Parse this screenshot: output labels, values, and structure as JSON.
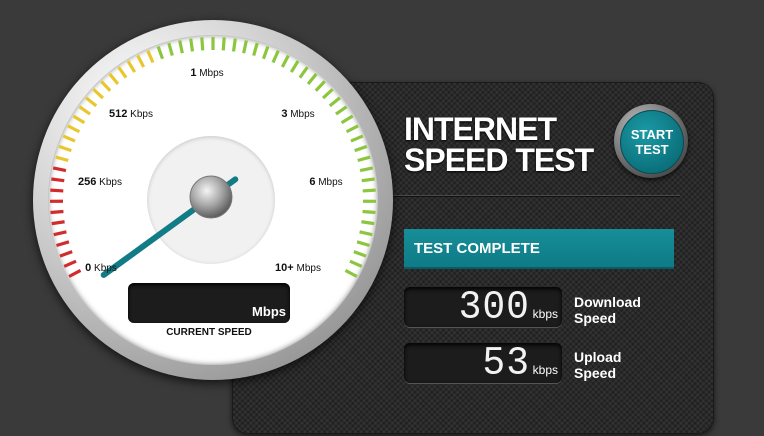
{
  "title_line1": "INTERNET",
  "title_line2": "SPEED TEST",
  "start_button": {
    "line1": "START",
    "line2": "TEST"
  },
  "status": "TEST COMPLETE",
  "download": {
    "value": "300",
    "unit": "kbps",
    "label_line1": "Download",
    "label_line2": "Speed"
  },
  "upload": {
    "value": "53",
    "unit": "kbps",
    "label_line1": "Upload",
    "label_line2": "Speed"
  },
  "gauge": {
    "current_speed_unit": "Mbps",
    "current_speed_label": "CURRENT SPEED",
    "needle_value_kbps": 300,
    "ticks": {
      "t0": {
        "num": "0",
        "unit": "Kbps"
      },
      "t1": {
        "num": "256",
        "unit": "Kbps"
      },
      "t2": {
        "num": "512",
        "unit": "Kbps"
      },
      "t3": {
        "num": "1",
        "unit": "Mbps"
      },
      "t4": {
        "num": "3",
        "unit": "Mbps"
      },
      "t5": {
        "num": "6",
        "unit": "Mbps"
      },
      "t6": {
        "num": "10+",
        "unit": "Mbps"
      }
    }
  },
  "colors": {
    "accent": "#0e7f89",
    "needle": "#127c86",
    "tick_red": "#d12b2b",
    "tick_yellow": "#e8c72e",
    "tick_green": "#8cc63f"
  }
}
